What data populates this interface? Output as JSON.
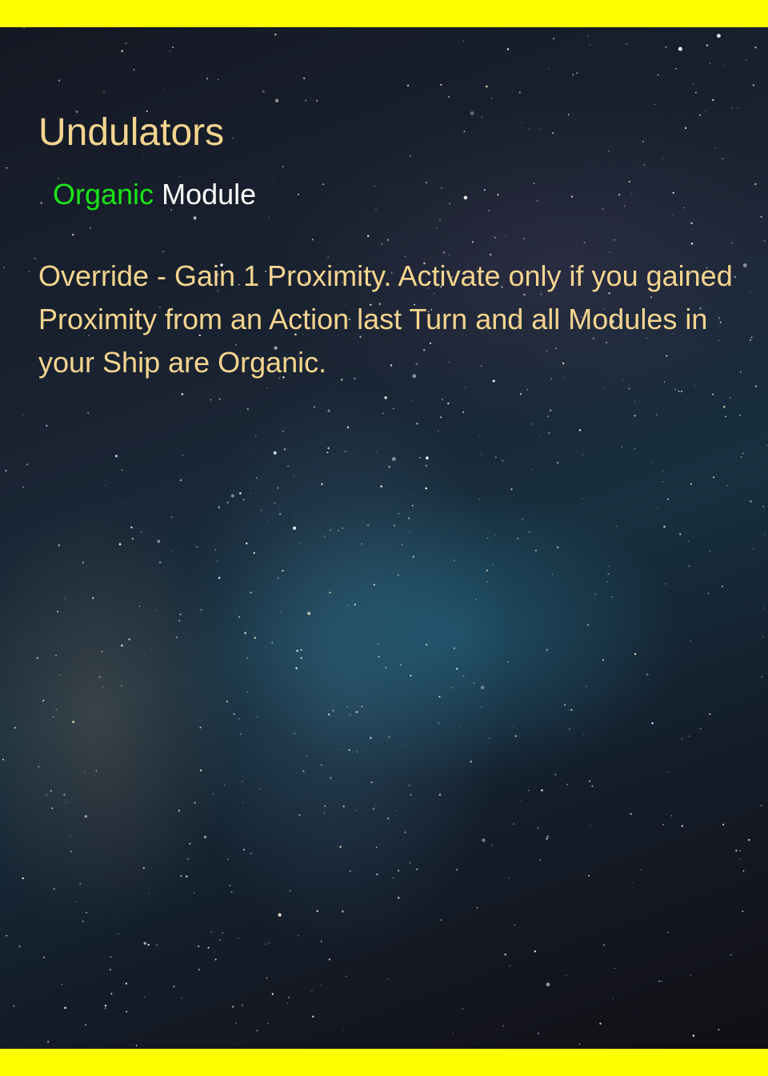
{
  "card": {
    "title": "Undulators",
    "type_keyword": "Organic",
    "type_label": "Module",
    "rules_text": "Override - Gain 1 Proximity. Activate only if you gained Proximity from an Action last Turn and all Modules in your Ship are Organic."
  },
  "colors": {
    "border": "#ffff00",
    "title": "#f5d58f",
    "keyword": "#19e619",
    "type_label": "#ffffff",
    "rules": "#f5d58f"
  },
  "background": {
    "icon": "starfield-milky-way"
  }
}
